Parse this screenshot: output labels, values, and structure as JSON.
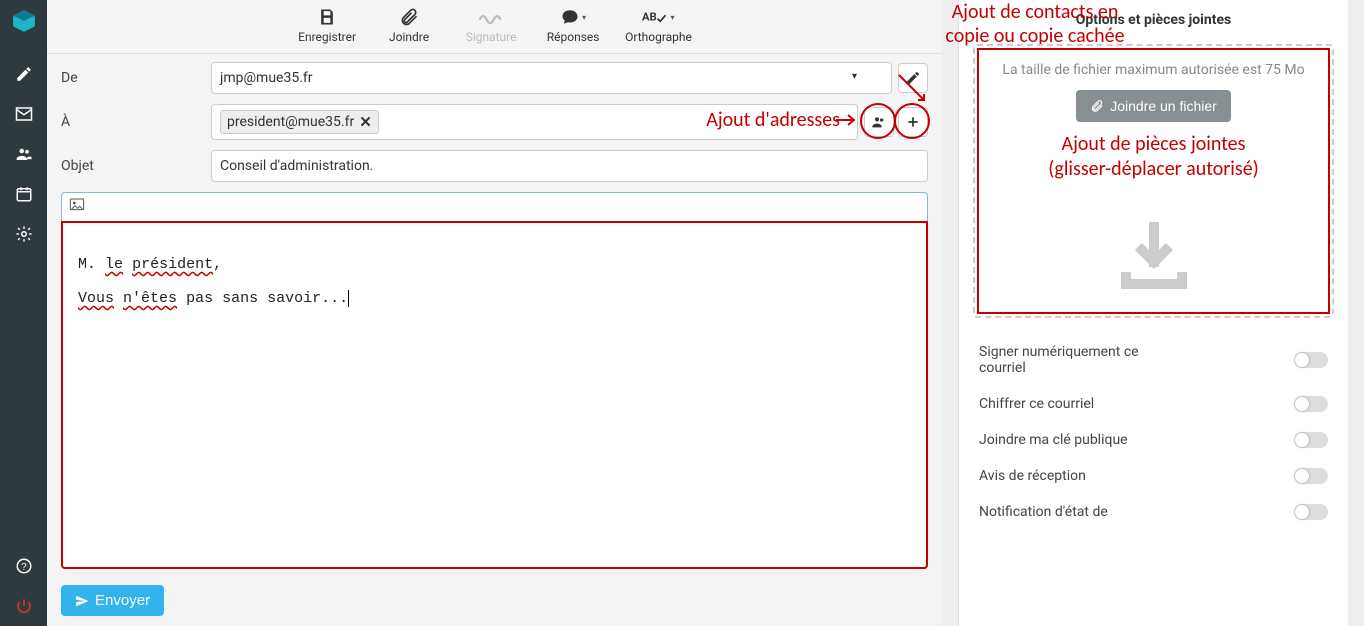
{
  "toolbar": {
    "save": "Enregistrer",
    "attach": "Joindre",
    "signature": "Signature",
    "responses": "Réponses",
    "spellcheck": "Orthographe"
  },
  "fields": {
    "from_label": "De",
    "from_value": "jmp@mue35.fr",
    "to_label": "À",
    "to_chip": "president@mue35.fr",
    "subject_label": "Objet",
    "subject_value": "Conseil d'administration."
  },
  "body": {
    "line1_a": "M.",
    "line1_b": "le",
    "line1_c": "président",
    "line1_d": ",",
    "line2_a": "Vous",
    "line2_b": "n'êtes",
    "line2_c": "pas sans savoir..."
  },
  "send": "Envoyer",
  "rightpanel": {
    "title": "Options et pièces jointes",
    "maxsize": "La taille de fichier maximum autorisée est 75 Mo",
    "attach_btn": "Joindre un fichier"
  },
  "options": {
    "sign": "Signer numériquement ce courriel",
    "encrypt": "Chiffrer ce courriel",
    "pubkey": "Joindre ma clé publique",
    "receipt": "Avis de réception",
    "dsn": "Notification d'état de"
  },
  "annotations": {
    "cc": "Ajout de contacts en\ncopie ou copie cachée",
    "addr": "Ajout d'adresses",
    "attach": "Ajout de pièces jointes\n(glisser-déplacer autorisé)"
  }
}
